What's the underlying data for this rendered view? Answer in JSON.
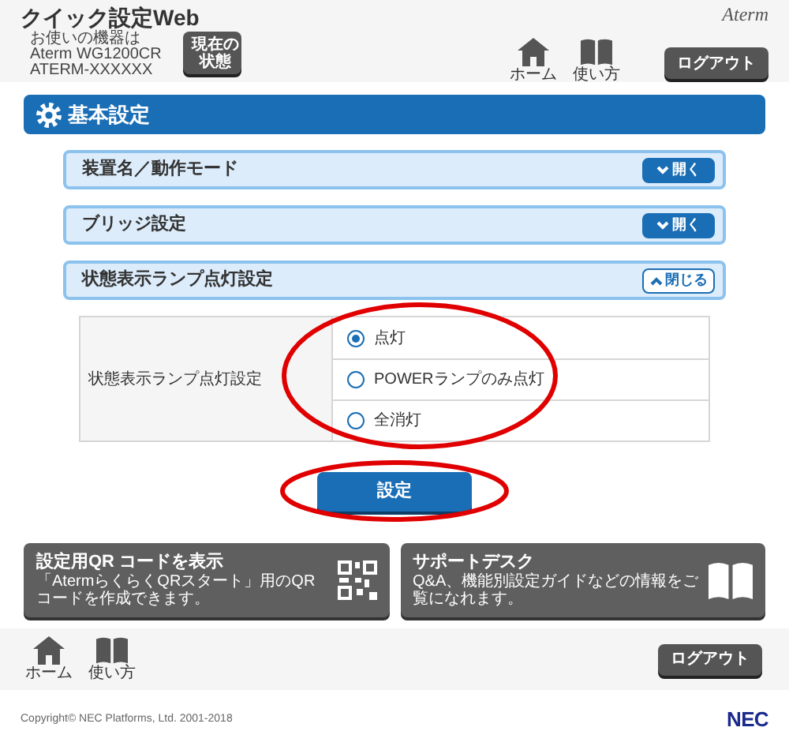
{
  "header": {
    "title": "クイック設定Web",
    "device_lines": [
      "お使いの機器は",
      "Aterm WG1200CR",
      "ATERM-XXXXXX"
    ],
    "status_button": [
      "現在の",
      "状態"
    ],
    "brand": "Aterm",
    "nav": [
      {
        "label": "ホーム",
        "kind": "home"
      },
      {
        "label": "使い方",
        "kind": "guide"
      }
    ],
    "logout": "ログアウト"
  },
  "section": {
    "title": "基本設定",
    "panels": [
      {
        "title": "装置名／動作モード",
        "expanded": false,
        "toggle": "開く"
      },
      {
        "title": "ブリッジ設定",
        "expanded": false,
        "toggle": "開く"
      },
      {
        "title": "状態表示ランプ点灯設定",
        "expanded": true,
        "toggle": "閉じる"
      }
    ]
  },
  "form": {
    "label": "状態表示ランプ点灯設定",
    "options": [
      {
        "label": "点灯",
        "selected": true
      },
      {
        "label": "POWERランプのみ点灯",
        "selected": false
      },
      {
        "label": "全消灯",
        "selected": false
      }
    ]
  },
  "submit": "設定",
  "cards": [
    {
      "kind": "qr",
      "title": "設定用QR コードを表示",
      "description": "「AtermらくらくQRスタート」用のQRコードを作成できます。"
    },
    {
      "kind": "book",
      "title": "サポートデスク",
      "description": "Q&A、機能別設定ガイドなどの情報をご覧になれます。"
    }
  ],
  "footer": {
    "nav": [
      {
        "label": "ホーム",
        "kind": "home"
      },
      {
        "label": "使い方",
        "kind": "guide"
      }
    ],
    "logout": "ログアウト"
  },
  "copyright": "Copyright© NEC Platforms, Ltd. 2001-2018",
  "logo": "NEC"
}
